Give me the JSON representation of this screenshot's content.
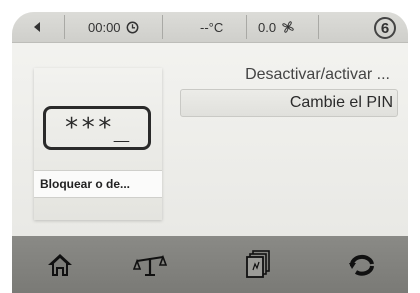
{
  "status_bar": {
    "time": "00:00",
    "temperature": "--°C",
    "fan_value": "0.0",
    "page_number": "6",
    "icons": [
      "back-arrow-icon",
      "clock-icon",
      "fan-icon"
    ]
  },
  "tile": {
    "pin_mask": "***_",
    "label": "Bloquear o de..."
  },
  "menu": {
    "items": [
      {
        "label": "Desactivar/activar ..."
      },
      {
        "label": "Cambie el PIN"
      }
    ]
  },
  "bottom_nav": {
    "items": [
      "home-icon",
      "balance-icon",
      "pages-icon",
      "replay-icon"
    ]
  },
  "colors": {
    "bottom_bar": "#808080",
    "text": "#333333"
  }
}
